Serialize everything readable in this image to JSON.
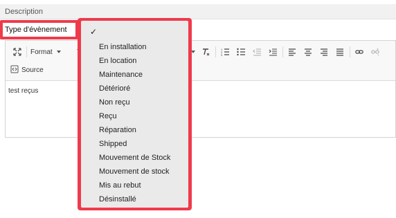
{
  "description": {
    "label": "Description"
  },
  "type_field": {
    "label": "Type d'évènement"
  },
  "toolbar": {
    "format_label": "Format",
    "truncated_label": "T",
    "source_label": "Source"
  },
  "editor": {
    "content": "test reçus"
  },
  "dropdown": {
    "check": "✓",
    "options": [
      "En installation",
      "En location",
      "Maintenance",
      "Détérioré",
      "Non reçu",
      "Reçu",
      "Réparation",
      "Shipped",
      "Mouvement de Stock",
      "Mouvement de stock",
      "Mis au rebut",
      "Désinstallé"
    ]
  },
  "colors": {
    "highlight": "#ef3a4b",
    "dropdown_bg": "#eaeaea"
  }
}
